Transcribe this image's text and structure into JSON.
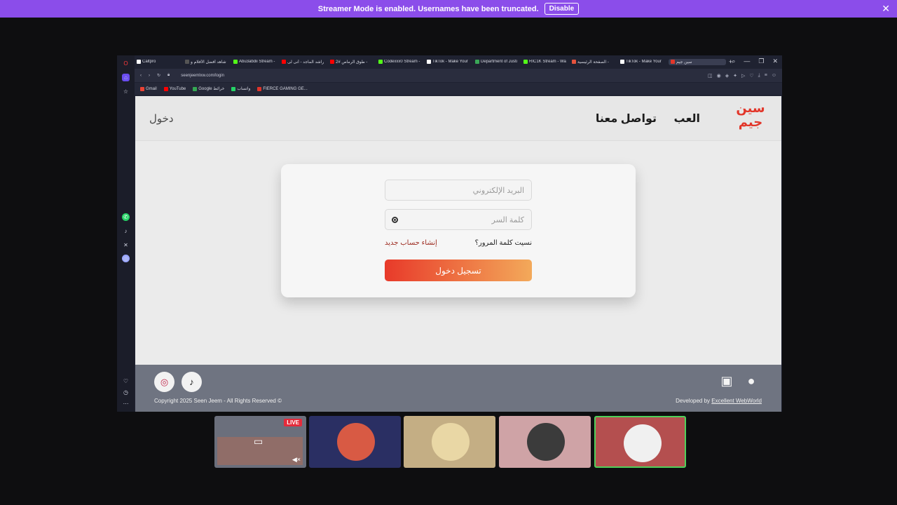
{
  "banner": {
    "message": "Streamer Mode is enabled. Usernames have been truncated.",
    "button": "Disable",
    "close": "✕"
  },
  "browser": {
    "tabs": [
      {
        "label": "Caltpro",
        "color": "#ffffff"
      },
      {
        "label": "شاهد أفضل الأفلام و",
        "color": "#555555"
      },
      {
        "label": "Abu3abdii Stream -",
        "color": "#53fc18"
      },
      {
        "label": "راشد الماجد - أنى لى",
        "color": "#ff0000"
      },
      {
        "label": "طوق الرماص #2 -",
        "color": "#ff0000"
      },
      {
        "label": "Codexxx0 Stream -",
        "color": "#53fc18"
      },
      {
        "label": "TikTok - Make Your",
        "color": "#ffffff"
      },
      {
        "label": "Department of Justi",
        "color": "#3aa757"
      },
      {
        "label": "RIC1K Stream - Wa",
        "color": "#53fc18"
      },
      {
        "label": "الصفحة الرئيسية -",
        "color": "#e5533d"
      },
      {
        "label": "TikTok - Make Your",
        "color": "#ffffff"
      },
      {
        "label": "سين جيم",
        "color": "#e2362a"
      }
    ],
    "url": "seenjeemlxw.com/login",
    "bookmarks": [
      {
        "label": "Gmail",
        "color": "#ea4335"
      },
      {
        "label": "YouTube",
        "color": "#ff0000"
      },
      {
        "label": "Google خرائط",
        "color": "#34a853"
      },
      {
        "label": "واتساب",
        "color": "#25d366"
      },
      {
        "label": "FIERCE GAMING GE...",
        "color": "#e0342a"
      }
    ]
  },
  "site": {
    "logo_line1": "سين",
    "logo_line2": "جيم",
    "nav": {
      "play": "العب",
      "contact": "تواصل معنا",
      "login": "دخول"
    },
    "form": {
      "email_placeholder": "البريد الإلكتروني",
      "password_placeholder": "كلمة السر",
      "forgot": "نسيت كلمة المرور؟",
      "signup": "إنشاء حساب جديد",
      "submit": "تسجيل دخول"
    },
    "footer": {
      "copyright": "Copyright 2025 Seen Jeem - All Rights Reserved ©",
      "developed_by": "Developed by",
      "developer": "Excellent WebWorld"
    }
  },
  "cams": [
    {
      "kind": "stream",
      "live": "LIVE",
      "bg": "#6b6f7c"
    },
    {
      "kind": "user",
      "bg": "#2a2f63",
      "avatar": "#d85a44"
    },
    {
      "kind": "user",
      "bg": "#c4ae84",
      "avatar": "#e9d7a5"
    },
    {
      "kind": "user",
      "bg": "#cfa3a6",
      "avatar": "#3b3b3b"
    },
    {
      "kind": "user",
      "bg": "#b44f4f",
      "avatar": "#f0f0f0",
      "highlight": "#4fd05a"
    }
  ]
}
